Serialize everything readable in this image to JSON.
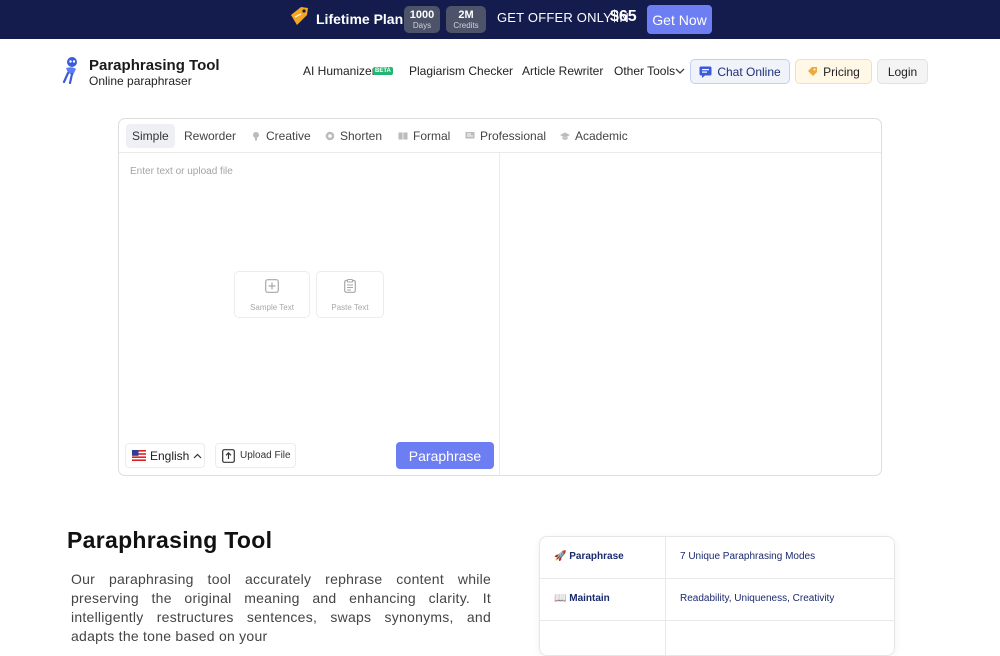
{
  "promo": {
    "plan": "Lifetime Plan",
    "stats": [
      {
        "value": "1000",
        "unit": "Days"
      },
      {
        "value": "2M",
        "unit": "Credits"
      }
    ],
    "offer": "GET OFFER ONLY IN",
    "price": "$65",
    "cta": "Get Now"
  },
  "header": {
    "brand": "Paraphrasing Tool",
    "tagline": "Online paraphraser",
    "nav": [
      "AI Humanizer",
      "Plagiarism Checker",
      "Article Rewriter",
      "Other Tools"
    ],
    "beta": "BETA",
    "chat": "Chat Online",
    "pricing": "Pricing",
    "login": "Login"
  },
  "editor": {
    "modes": [
      "Simple",
      "Reworder",
      "Creative",
      "Shorten",
      "Formal",
      "Professional",
      "Academic"
    ],
    "active_mode": "Simple",
    "placeholder": "Enter text or upload file",
    "sample": "Sample Text",
    "paste": "Paste Text",
    "language": "English",
    "upload": "Upload File",
    "paraphrase": "Paraphrase"
  },
  "content": {
    "title": "Paraphrasing Tool",
    "description": "Our paraphrasing tool accurately rephrase content while preserving the original meaning and enhancing clarity. It intelligently restructures sentences, swaps synonyms, and adapts the tone based on your",
    "features": [
      {
        "key": "Paraphrase",
        "value": "7 Unique Paraphrasing Modes"
      },
      {
        "key": "Maintain",
        "value": "Readability, Uniqueness, Creativity"
      }
    ]
  },
  "colors": {
    "banner": "#141c4d",
    "accent": "#6c7ef2",
    "beta": "#22b573"
  }
}
